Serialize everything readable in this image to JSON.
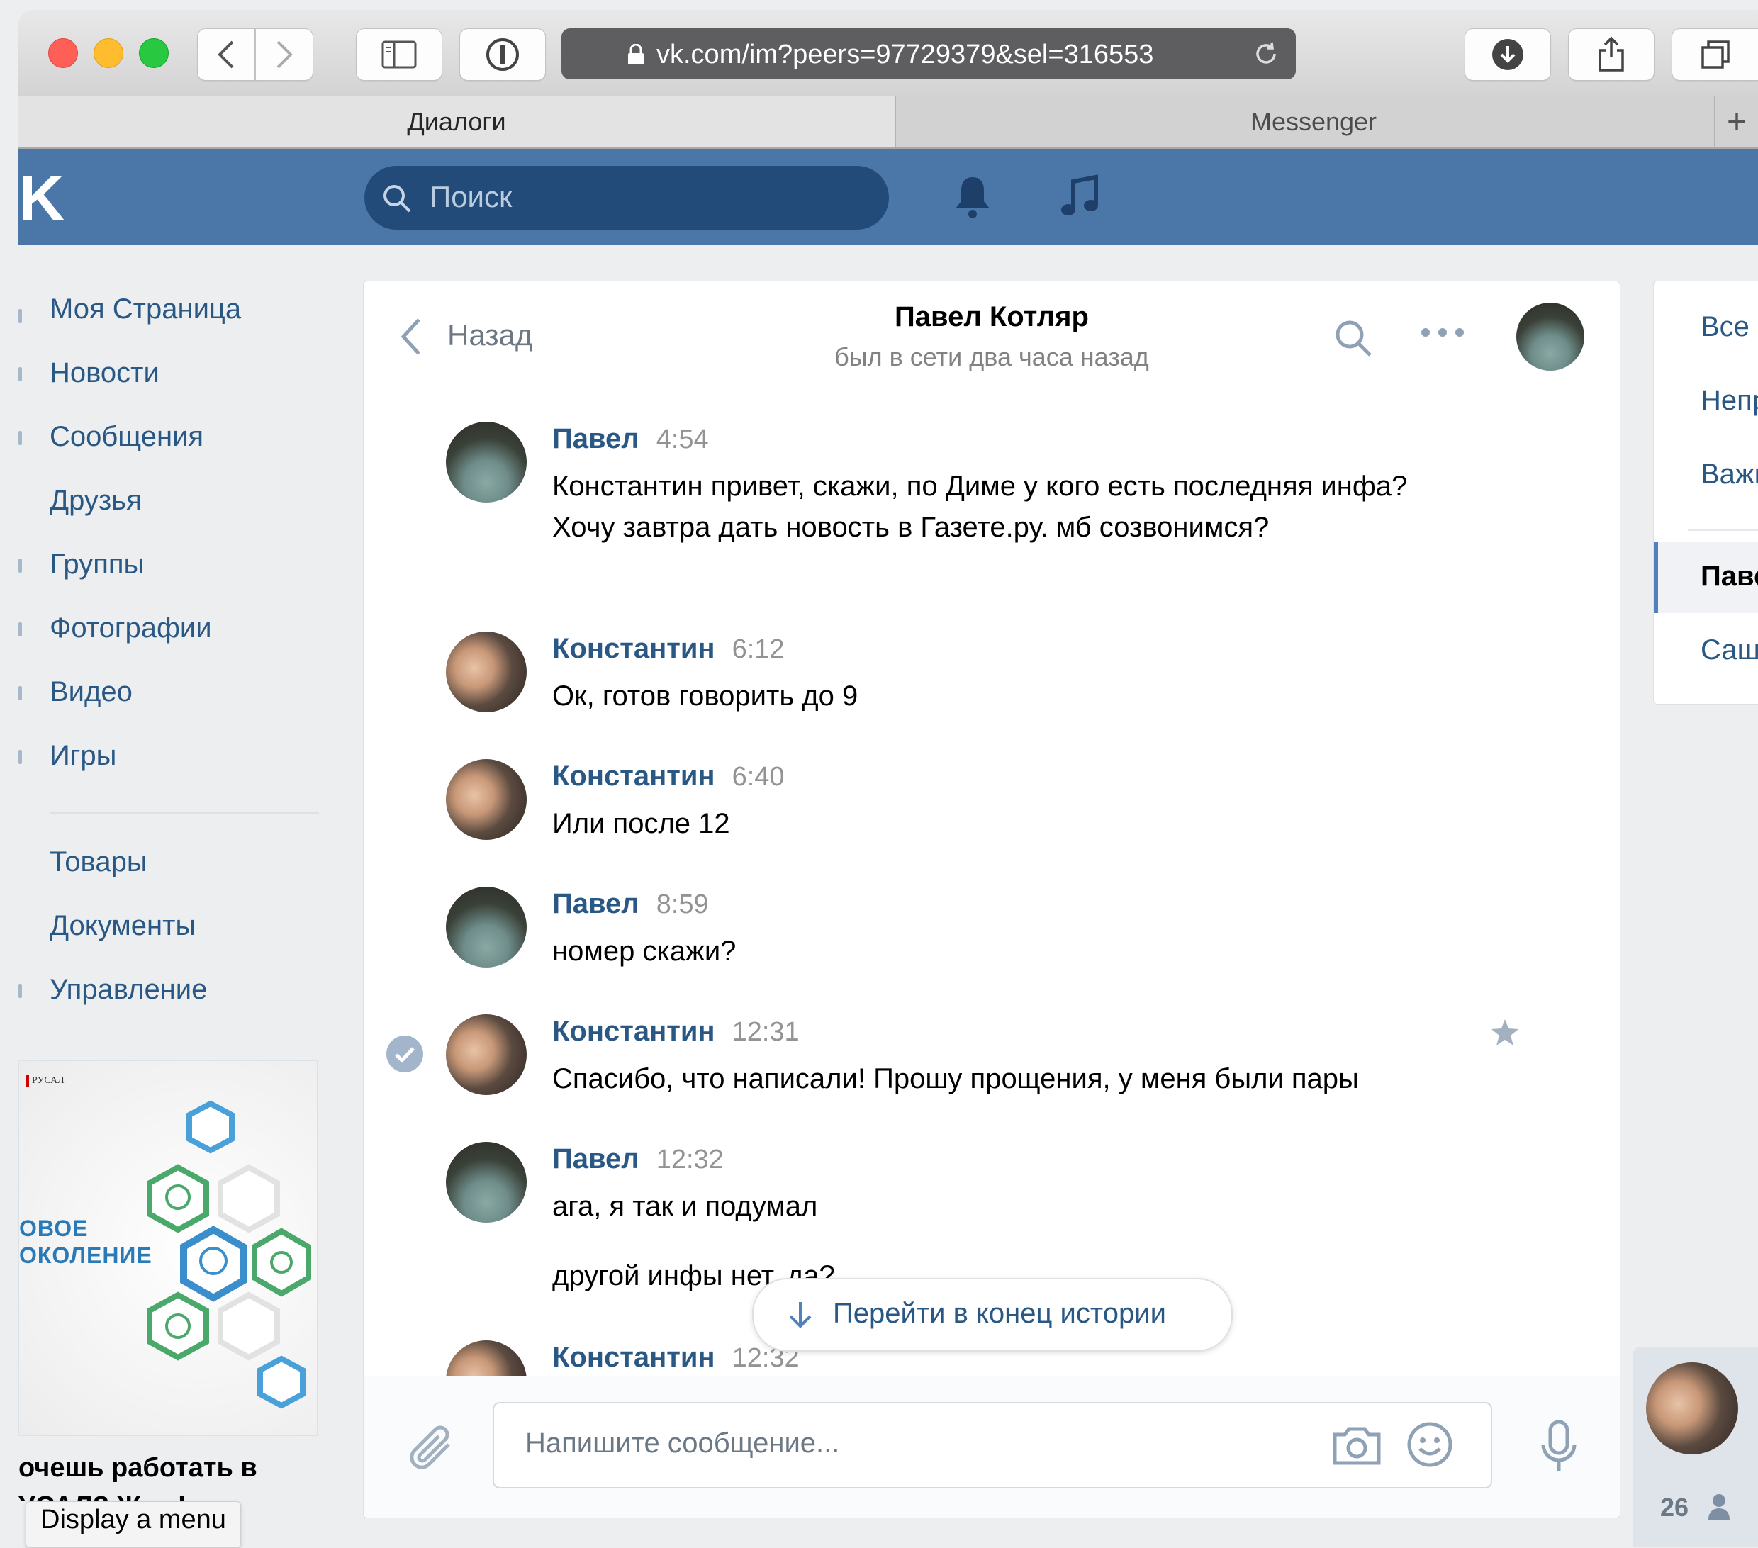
{
  "browser": {
    "url": "vk.com/im?peers=97729379&sel=316553",
    "tabs": [
      {
        "label": "Диалоги",
        "active": true
      },
      {
        "label": "Messenger",
        "active": false
      }
    ],
    "new_tab_label": "+"
  },
  "header": {
    "logo": "K",
    "search_placeholder": "Поиск",
    "accent_color": "#4a76a8"
  },
  "left_nav": {
    "items": [
      "Моя Страница",
      "Новости",
      "Сообщения",
      "Друзья",
      "Группы",
      "Фотографии",
      "Видео",
      "Игры"
    ],
    "items_secondary": [
      "Товары",
      "Документы",
      "Управление"
    ]
  },
  "ad": {
    "logo_text": "РУСАЛ",
    "line1": "ОВОЕ",
    "line2": "ОКОЛЕНИЕ",
    "caption_line1": "очешь работать в",
    "caption_line2": "УСАЛ? Жми!"
  },
  "tooltip": "Display a menu",
  "chat": {
    "back_label": "Назад",
    "peer_name": "Павел Котляр",
    "peer_status": "был в сети два часа назад",
    "messages": [
      {
        "sender": "Павел",
        "time": "4:54",
        "text": "Константин привет, скажи, по Диме у кого есть последняя инфа? Хочу завтра дать новость в Газете.ру. мб созвонимся?"
      },
      {
        "sender": "Константин",
        "time": "6:12",
        "text": "Ок, готов говорить до 9"
      },
      {
        "sender": "Константин",
        "time": "6:40",
        "text": "Или после 12"
      },
      {
        "sender": "Павел",
        "time": "8:59",
        "text": "номер скажи?"
      },
      {
        "sender": "Константин",
        "time": "12:31",
        "text": "Спасибо, что написали! Прошу прощения, у меня были пары"
      },
      {
        "sender": "Павел",
        "time": "12:32",
        "text": "ага, я так и подумал",
        "text2": "другой инфы нет, да?"
      },
      {
        "sender": "Константин",
        "time": "12:32",
        "text": ""
      }
    ],
    "jump_label": "Перейти в конец истории",
    "composer_placeholder": "Напишите сообщение..."
  },
  "right_menu": {
    "items": [
      "Все",
      "Непрочитанные",
      "Важные"
    ],
    "conversations": [
      "Павел Котляр",
      "Саша"
    ]
  },
  "mini_chat": {
    "count": "26"
  }
}
